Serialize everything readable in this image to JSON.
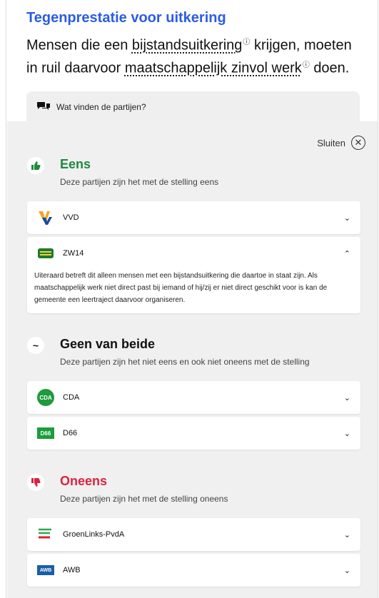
{
  "header": {
    "kicker": "Tegenprestatie voor uitkering",
    "statement_part1": "Mensen die een",
    "term1": "bijstandsuitkering",
    "statement_part2": "krijgen, moeten in ruil daarvoor",
    "term2": "maatschappelijk zinvol werk",
    "statement_part3": "doen.",
    "info_glyph": "ⓘ"
  },
  "tab": {
    "label": "Wat vinden de partijen?",
    "icon": "chat-bubbles-icon"
  },
  "close": {
    "label": "Sluiten",
    "glyph": "✕"
  },
  "groups": [
    {
      "title": "Eens",
      "subtitle": "Deze partijen zijn het met de stelling eens",
      "color": "#1f8a3b",
      "icon": "thumbs-up-icon",
      "glyph": "👍",
      "parties": [
        {
          "name": "VVD",
          "chevron": "⌄"
        },
        {
          "name": "ZW14",
          "chevron": "⌃",
          "expanded": true,
          "explanation": "Uiteraard betreft dit alleen mensen met een bijstandsuitkering die daartoe in staat zijn. Als maatschappelijk werk niet direct past bij iemand of hij/zij er niet direct geschikt voor is kan de gemeente een leertraject daarvoor organiseren."
        }
      ]
    },
    {
      "title": "Geen van beide",
      "subtitle": "Deze partijen zijn het niet eens en ook niet oneens met de stelling",
      "color": "#111111",
      "icon": "tilde-icon",
      "glyph": "~",
      "parties": [
        {
          "name": "CDA",
          "chevron": "⌄",
          "logo_text": "CDA"
        },
        {
          "name": "D66",
          "chevron": "⌄",
          "logo_text": "D66"
        }
      ]
    },
    {
      "title": "Oneens",
      "subtitle": "Deze partijen zijn het met de stelling oneens",
      "color": "#d9233f",
      "icon": "thumbs-down-icon",
      "glyph": "👎",
      "parties": [
        {
          "name": "GroenLinks-PvdA",
          "chevron": "⌄"
        },
        {
          "name": "AWB",
          "chevron": "⌄",
          "logo_text": "AWB"
        }
      ]
    }
  ]
}
